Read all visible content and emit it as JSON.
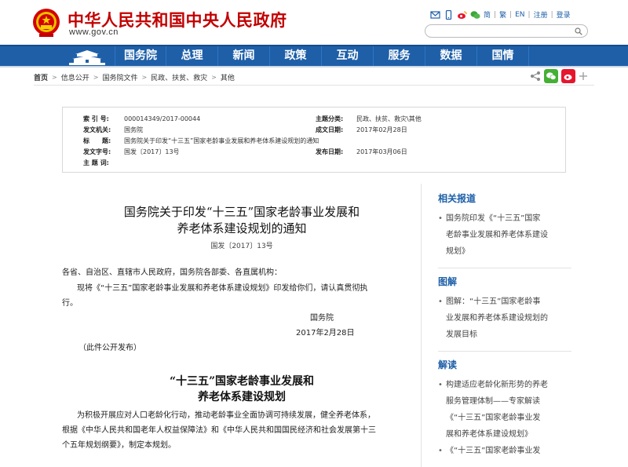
{
  "header": {
    "site_name": "中华人民共和国中央人民政府",
    "site_url": "www.gov.cn",
    "lang_simplified": "简",
    "lang_traditional": "繁",
    "lang_en": "EN",
    "register": "注册",
    "login": "登录",
    "search_placeholder": ""
  },
  "nav": {
    "items": [
      "国务院",
      "总理",
      "新闻",
      "政策",
      "互动",
      "服务",
      "数据",
      "国情"
    ]
  },
  "breadcrumb": {
    "items": [
      "首页",
      "信息公开",
      "国务院文件",
      "民政、扶贫、救灾",
      "其他"
    ]
  },
  "meta": {
    "index_label": "索 引 号:",
    "index_value": "000014349/2017-00044",
    "category_label": "主题分类:",
    "category_value": "民政、扶贫、救灾\\其他",
    "issuer_label": "发文机关:",
    "issuer_value": "国务院",
    "written_label": "成文日期:",
    "written_value": "2017年02月28日",
    "title_label": "标　　题:",
    "title_value": "国务院关于印发“十三五”国家老龄事业发展和养老体系建设规划的通知",
    "docno_label": "发文字号:",
    "docno_value": "国发〔2017〕13号",
    "publish_label": "发布日期:",
    "publish_value": "2017年03月06日",
    "subject_label": "主 题 词:",
    "subject_value": ""
  },
  "article": {
    "title_line1": "国务院关于印发“十三五”国家老龄事业发展和",
    "title_line2": "养老体系建设规划的通知",
    "doc_number": "国发〔2017〕13号",
    "recipients": "各省、自治区、直辖市人民政府，国务院各部委、各直属机构：",
    "body_line1": "现将《“十三五”国家老龄事业发展和养老体系建设规划》印发给你们，请认真贯彻执",
    "body_line2": "行。",
    "signature": "国务院",
    "date": "2017年2月28日",
    "publish_note": "（此件公开发布）",
    "plan_title_line1": "“十三五”国家老龄事业发展和",
    "plan_title_line2": "养老体系建设规划",
    "plan_line1": "为积极开展应对人口老龄化行动，推动老龄事业全面协调可持续发展，健全养老体系，",
    "plan_line2": "根据《中华人民共和国老年人权益保障法》和《中华人民共和国国民经济和社会发展第十三",
    "plan_line3": "个五年规划纲要》，制定本规划。"
  },
  "sidebar": {
    "related_title": "相关报道",
    "related_line1": "国务院印发《“十三五”国家",
    "related_line2": "老龄事业发展和养老体系建设",
    "related_line3": "规划》",
    "graphic_title": "图解",
    "graphic_line1": "图解：“十三五”国家老龄事",
    "graphic_line2": "业发展和养老体系建设规划的",
    "graphic_line3": "发展目标",
    "interpret_title": "解读",
    "interpret_line1": "构建适应老龄化新形势的养老",
    "interpret_line2": "服务管理体制——专家解读",
    "interpret_line3": "《“十三五”国家老龄事业发",
    "interpret_line4": "展和养老体系建设规划》",
    "interpret2_line1": "《“十三五”国家老龄事业发"
  },
  "colors": {
    "brand_red": "#c20000",
    "nav_blue": "#1e5fa8",
    "link_blue": "#1e5fa8"
  },
  "icons": [
    "national-emblem-icon",
    "mail-icon",
    "mobile-icon",
    "weibo-icon",
    "wechat-icon",
    "tiananmen-gate-icon",
    "search-icon",
    "share-icon",
    "wechat-share-icon",
    "weibo-share-icon",
    "plus-icon"
  ]
}
